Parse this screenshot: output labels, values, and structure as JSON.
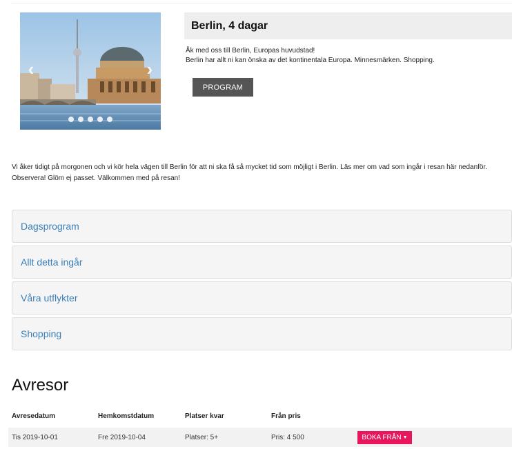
{
  "tour": {
    "title": "Berlin, 4 dagar",
    "intro_line1": "Åk med oss till Berlin, Europas huvudstad!",
    "intro_line2": "Berlin har allt ni kan önska av det kontinentala Europa. Minnesmärken. Shopping.",
    "program_button": "PROGRAM"
  },
  "carousel": {
    "slides": 5,
    "active_slide": 1,
    "prev_icon": "chevron-left-icon",
    "next_icon": "chevron-right-icon"
  },
  "description": "Vi åker tidigt på morgonen och vi kör hela vägen till Berlin för att ni ska få så mycket tid som möjligt i Berlin. Läs mer om vad som ingår i resan här nedanför. Observera! Glöm ej passet. Välkommen med på resan!",
  "accordion": [
    {
      "label": "Dagsprogram"
    },
    {
      "label": "Allt detta ingår"
    },
    {
      "label": "Våra utflykter"
    },
    {
      "label": "Shopping"
    }
  ],
  "departures": {
    "title": "Avresor",
    "headers": [
      "Avresedatum",
      "Hemkomstdatum",
      "Platser kvar",
      "Från pris"
    ],
    "rows": [
      {
        "departure": "Tis 2019-10-01",
        "return": "Fre 2019-10-04",
        "seats": "Platser: 5+",
        "price": "Pris: 4 500",
        "book_label": "BOKA FRÅN"
      }
    ]
  },
  "colors": {
    "accent_pink": "#e8175d",
    "link_blue": "#3a7fb8",
    "button_gray": "#555555"
  }
}
